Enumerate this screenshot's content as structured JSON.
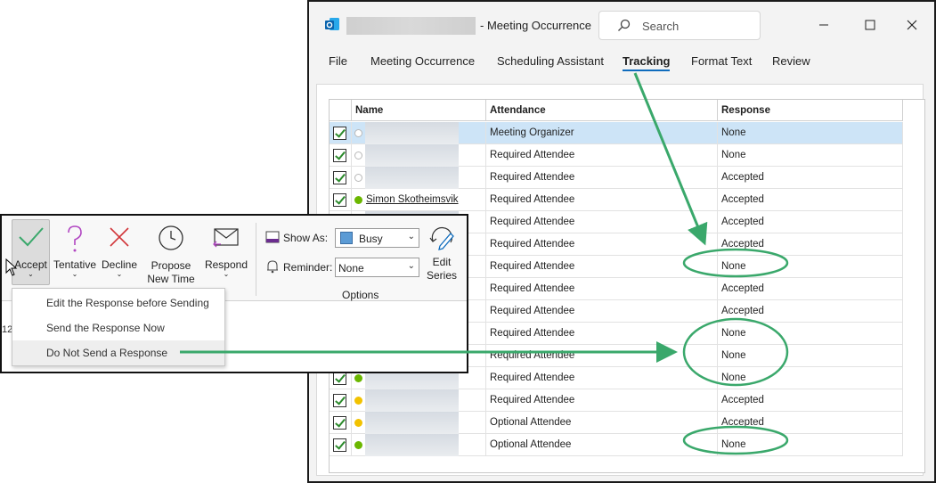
{
  "window": {
    "title": "- Meeting Occurrence",
    "search_placeholder": "Search",
    "menu": [
      "File",
      "Meeting Occurrence",
      "Scheduling Assistant",
      "Tracking",
      "Format Text",
      "Review"
    ],
    "active_tab": "Tracking"
  },
  "tracking": {
    "columns": [
      "Name",
      "Attendance",
      "Response"
    ],
    "rows": [
      {
        "name": "",
        "attendance": "Meeting Organizer",
        "response": "None",
        "status": "none",
        "selected": true
      },
      {
        "name": "",
        "attendance": "Required Attendee",
        "response": "None",
        "status": "none"
      },
      {
        "name": "",
        "attendance": "Required Attendee",
        "response": "Accepted",
        "status": "none"
      },
      {
        "name": "Simon Skotheimsvik",
        "attendance": "Required Attendee",
        "response": "Accepted",
        "status": "available"
      },
      {
        "name": "",
        "attendance": "Required Attendee",
        "response": "Accepted",
        "status": "busy"
      },
      {
        "name": "",
        "attendance": "Required Attendee",
        "response": "Accepted",
        "status": "hidden"
      },
      {
        "name": "",
        "attendance": "Required Attendee",
        "response": "None",
        "status": "hidden"
      },
      {
        "name": "",
        "attendance": "Required Attendee",
        "response": "Accepted",
        "status": "hidden"
      },
      {
        "name": "",
        "attendance": "Required Attendee",
        "response": "Accepted",
        "status": "hidden"
      },
      {
        "name": "",
        "attendance": "Required Attendee",
        "response": "None",
        "status": "hidden"
      },
      {
        "name": "",
        "attendance": "Required Attendee",
        "response": "None",
        "status": "hidden"
      },
      {
        "name": "",
        "attendance": "Required Attendee",
        "response": "None",
        "status": "available"
      },
      {
        "name": "",
        "attendance": "Required Attendee",
        "response": "Accepted",
        "status": "away"
      },
      {
        "name": "",
        "attendance": "Optional Attendee",
        "response": "Accepted",
        "status": "away"
      },
      {
        "name": "",
        "attendance": "Optional Attendee",
        "response": "None",
        "status": "available"
      }
    ]
  },
  "ribbon": {
    "accept": "Accept",
    "tentative": "Tentative",
    "decline": "Decline",
    "propose_line1": "Propose",
    "propose_line2": "New Time",
    "respond": "Respond",
    "show_as_label": "Show As:",
    "show_as_value": "Busy",
    "reminder_label": "Reminder:",
    "reminder_value": "None",
    "edit_series_line1": "Edit",
    "edit_series_line2": "Series",
    "group_options": "Options",
    "accept_menu": [
      {
        "label": "Edit the Response before Sending",
        "accel": "E"
      },
      {
        "label": "Send the Response Now",
        "accel": "S"
      },
      {
        "label": "Do Not Send a Response",
        "accel": "D"
      }
    ],
    "fragment": "12"
  },
  "colors": {
    "accent": "#0f6cbd",
    "annotation": "#3aa86b",
    "available": "#6bb700",
    "away": "#f2c200",
    "busy": "#c4314b",
    "selected_row": "#cde4f7"
  }
}
